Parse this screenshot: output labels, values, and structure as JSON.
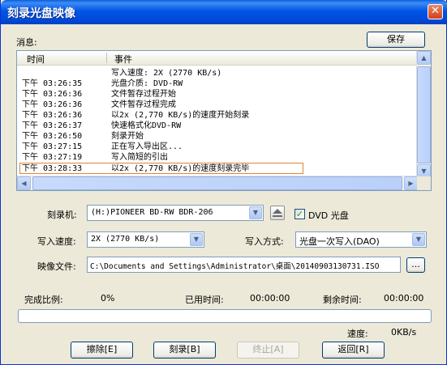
{
  "window": {
    "title": "刻录光盘映像",
    "close_glyph": "✕"
  },
  "log": {
    "label": "消息:",
    "save_button": "保存",
    "columns": {
      "time": "时间",
      "event": "事件"
    },
    "rows": [
      {
        "time": "",
        "event": "写入速度: 2X (2770 KB/s)"
      },
      {
        "time": "下午 03:26:35",
        "event": "光盘介质: DVD-RW"
      },
      {
        "time": "下午 03:26:36",
        "event": "文件暂存过程开始"
      },
      {
        "time": "下午 03:26:36",
        "event": "文件暂存过程完成"
      },
      {
        "time": "下午 03:26:36",
        "event": "以2x (2,770 KB/s)的速度开始刻录"
      },
      {
        "time": "下午 03:26:37",
        "event": "快速格式化DVD-RW"
      },
      {
        "time": "下午 03:26:50",
        "event": "刻录开始"
      },
      {
        "time": "下午 03:27:15",
        "event": "正在写入导出区..."
      },
      {
        "time": "下午 03:27:19",
        "event": "写入简短的引出"
      },
      {
        "time": "下午 03:28:33",
        "event": "以2x (2,770 KB/s)的速度刻录完毕"
      }
    ]
  },
  "recorder": {
    "label": "刻录机:",
    "value": "(H:)PIONEER  BD-RW   BDR-206",
    "dvd_label": "DVD 光盘",
    "dvd_checked": true
  },
  "write_speed": {
    "label": "写入速度:",
    "value": "2X (2770 KB/s)"
  },
  "write_mode": {
    "label": "写入方式:",
    "value": "光盘一次写入(DAO)"
  },
  "image_file": {
    "label": "映像文件:",
    "value": "C:\\Documents and Settings\\Administrator\\桌面\\20140903130731.ISO",
    "browse_label": "..."
  },
  "progress": {
    "completion_label": "完成比例:",
    "completion_value": "0%",
    "elapsed_label": "已用时间:",
    "elapsed_value": "00:00:00",
    "remaining_label": "剩余时间:",
    "remaining_value": "00:00:00",
    "fraction": 0,
    "speed_label": "速度:",
    "speed_value": "0KB/s"
  },
  "buttons": {
    "erase": "擦除[E]",
    "burn": "刻录[B]",
    "stop": "终止[A]",
    "back": "返回[R]"
  },
  "colors": {
    "titlebar": "#0055e5",
    "highlight_border": "#e0843a",
    "progress_fill": "#2fb12f"
  }
}
